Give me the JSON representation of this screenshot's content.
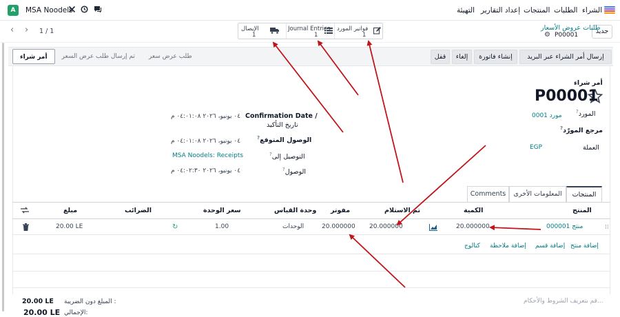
{
  "navbar": {
    "menu": [
      "الشراء",
      "الطلبات",
      "المنتجات",
      "إعداد التقارير",
      "التهيئة"
    ],
    "company": "MSA Noodels",
    "avatar_letter": "A"
  },
  "control": {
    "new_label": "جديد",
    "breadcrumb_parent": "طلبات عروض الأسعار",
    "breadcrumb_current": "P00001",
    "pager": "1 / 1",
    "smart_buttons": [
      {
        "title": "فواتير المورد",
        "count": "1",
        "icon": "edit-icon"
      },
      {
        "title": "Journal Entries",
        "count": "1",
        "icon": "list-icon"
      },
      {
        "title": "الإيصال",
        "count": "1",
        "icon": "truck-icon"
      }
    ]
  },
  "actions": {
    "send_email": "إرسال أمر الشراء عبر البريد الإلكتروني",
    "create_bill": "إنشاء فاتورة",
    "cancel": "إلغاء",
    "lock": "قفل"
  },
  "status": [
    "طلب عرض سعر",
    "تم إرسال طلب عرض السعر",
    "أمر شراء"
  ],
  "form": {
    "doc_type": "أمر شراء",
    "name": "P00001",
    "vendor_label": "المورد",
    "vendor_value": "مورد 0001",
    "vendor_ref_label": "مرجع المورّد",
    "currency_label": "العملة",
    "currency_value": "EGP",
    "confirm_label_en": "Confirmation Date /",
    "confirm_label_ar": "تاريخ التأكيد",
    "confirm_value": "٠٤ يونيو، ٢٠٢٦ ٠٤:٠١:٠٨ م",
    "expected_label": "الوصول المتوقع",
    "expected_value": "٠٤ يونيو، ٢٠٢٦ ٠٤:٠١:٠٨ م",
    "deliver_to_label": "التوصيل إلى",
    "deliver_to_value": "MSA Noodels: Receipts",
    "arrival_label": "الوصول",
    "arrival_value": "٠٤ يونيو، ٢٠٢٦ ٠٤:٠٢:٣٠ م"
  },
  "tabs": [
    "المنتجات",
    "المعلومات الأخرى",
    "Comments"
  ],
  "table": {
    "headers": [
      "المنتج",
      "الكمية",
      "تم الاستلام",
      "مفوتر",
      "وحدة القياس",
      "سعر الوحدة",
      "الضرائب",
      "مبلغ"
    ],
    "row": {
      "product": "منتج 000001",
      "qty": "20.000000",
      "received": "20.000000",
      "billed": "20.000000",
      "uom": "الوحدات",
      "price": "1.00",
      "taxes": "",
      "amount": "20.00 LE"
    },
    "add_links": [
      "إضافة منتج",
      "إضافة قسم",
      "إضافة ملاحظة",
      "كتالوج"
    ]
  },
  "footer": {
    "terms_placeholder": "قم بتعريف الشروط والأحكام...",
    "untaxed_label": "المبلغ دون الضريبة :",
    "untaxed_value": "20.00 LE",
    "total_label": "الإجمالي:",
    "total_value": "20.00 LE"
  },
  "colors": {
    "link": "#017e84",
    "annotation": "#c0151b",
    "avatar": "#22a06b"
  }
}
